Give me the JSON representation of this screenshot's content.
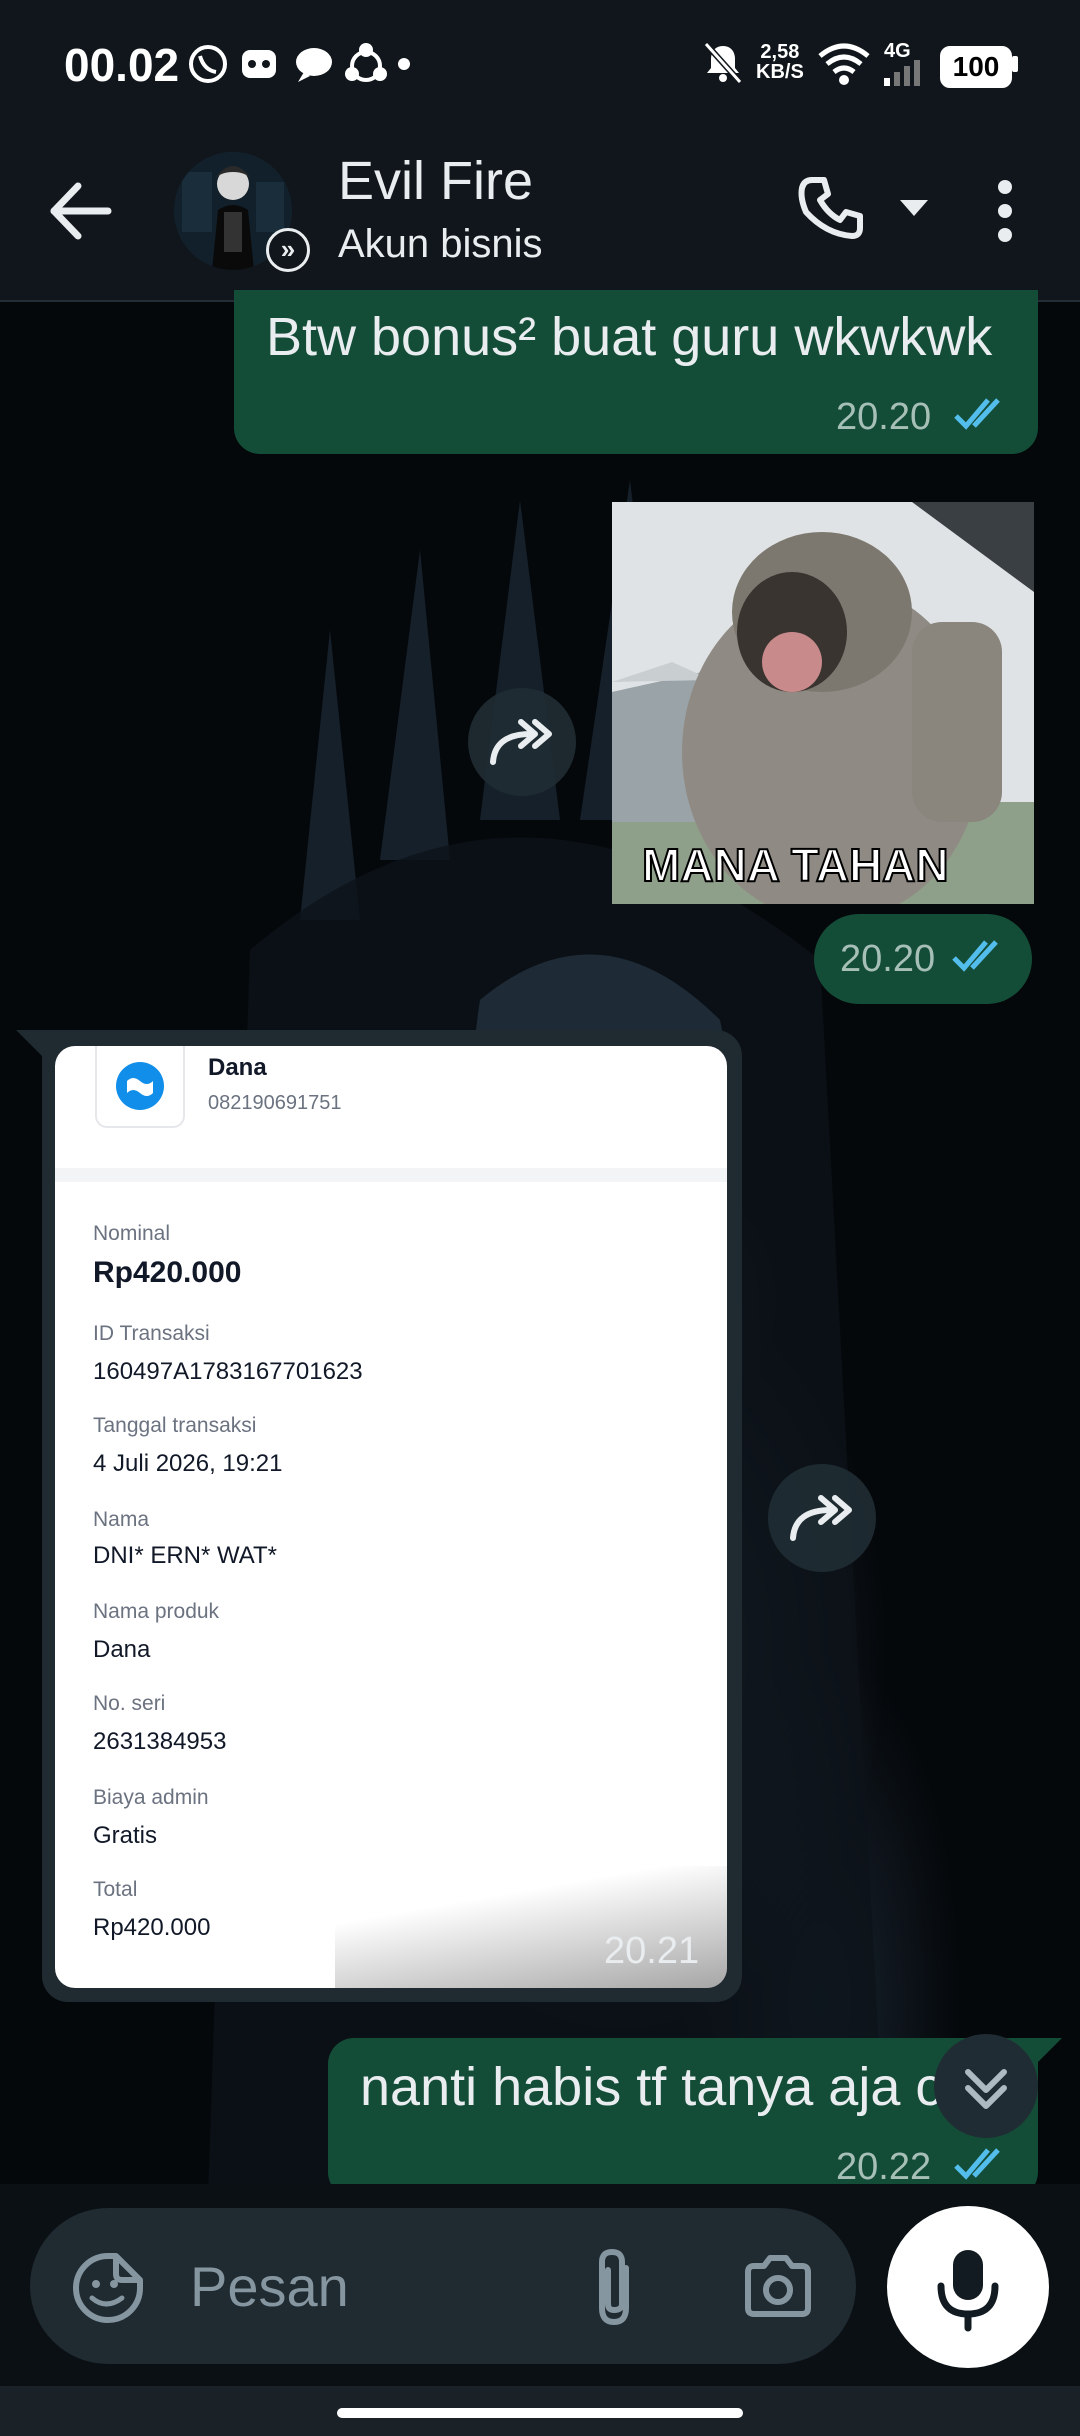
{
  "status_bar": {
    "time": "00.02",
    "net_speed_value": "2,58",
    "net_speed_unit": "KB/S",
    "network_type": "4G",
    "battery": "100"
  },
  "header": {
    "contact_name": "Evil Fire",
    "subtitle": "Akun bisnis"
  },
  "messages": [
    {
      "type": "text",
      "direction": "out",
      "text": "Btw bonus² buat guru wkwkwk",
      "time": "20.20",
      "status": "read"
    },
    {
      "type": "sticker",
      "direction": "out",
      "caption": "MANA TAHAN",
      "time": "20.20",
      "status": "read"
    },
    {
      "type": "image",
      "direction": "in",
      "time": "20.21"
    },
    {
      "type": "text",
      "direction": "out",
      "text": "nanti habis tf tanya aja c",
      "time": "20.22",
      "status": "read"
    }
  ],
  "receipt": {
    "merchant": "Dana",
    "account": "082190691751",
    "fields": [
      {
        "label": "Nominal",
        "value": "Rp420.000",
        "emphasis": true
      },
      {
        "label": "ID Transaksi",
        "value": "160497A1783167701623"
      },
      {
        "label": "Tanggal transaksi",
        "value": "4 Juli 2026, 19:21"
      },
      {
        "label": "Nama",
        "value": "DNI* ERN* WAT*"
      },
      {
        "label": "Nama produk",
        "value": "Dana"
      },
      {
        "label": "No. seri",
        "value": "2631384953"
      },
      {
        "label": "Biaya admin",
        "value": "Gratis"
      },
      {
        "label": "Total",
        "value": "Rp420.000"
      }
    ]
  },
  "composer": {
    "placeholder": "Pesan"
  },
  "colors": {
    "header_bg": "#10161b",
    "outgoing_bubble": "#144d37",
    "read_ticks": "#53bdeb",
    "input_bg": "#1f2a31"
  },
  "icons": [
    "back-arrow-icon",
    "business-badge-icon",
    "phone-icon",
    "dropdown-icon",
    "more-vert-icon",
    "forward-icon",
    "sticker-icon",
    "attach-icon",
    "camera-icon",
    "mic-icon",
    "scroll-down-icon"
  ]
}
